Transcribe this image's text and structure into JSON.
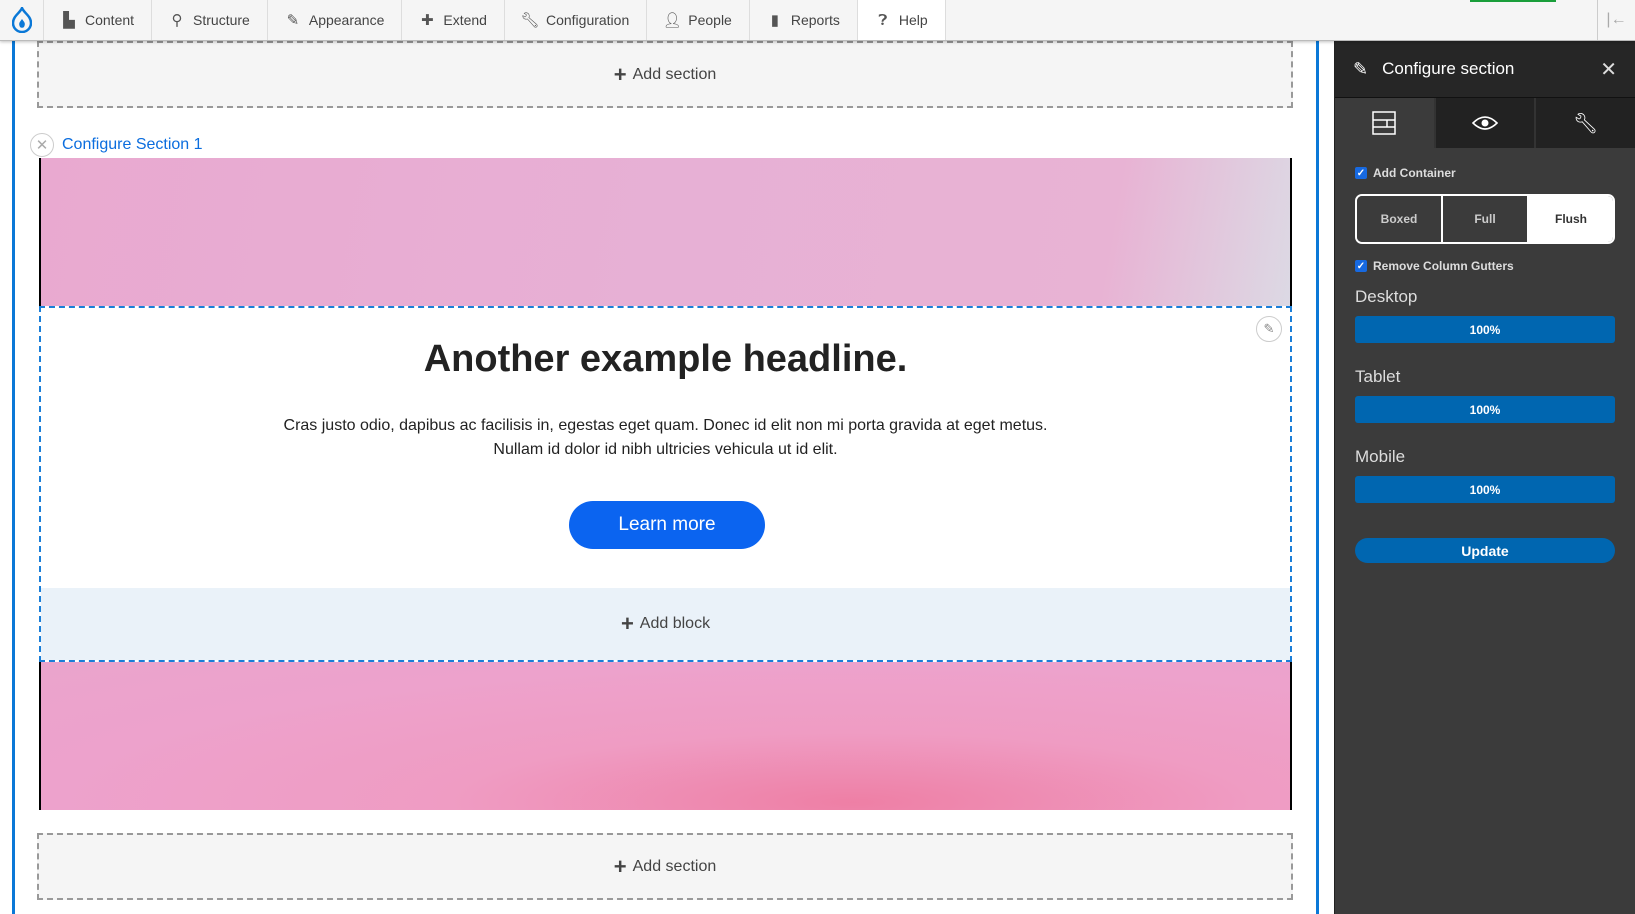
{
  "toolbar": {
    "items": [
      {
        "label": "Content",
        "icon": "file-icon"
      },
      {
        "label": "Structure",
        "icon": "sitemap-icon"
      },
      {
        "label": "Appearance",
        "icon": "brush-icon"
      },
      {
        "label": "Extend",
        "icon": "puzzle-icon"
      },
      {
        "label": "Configuration",
        "icon": "wrench-icon"
      },
      {
        "label": "People",
        "icon": "people-icon"
      },
      {
        "label": "Reports",
        "icon": "bar-chart-icon"
      },
      {
        "label": "Help",
        "icon": "help-icon"
      }
    ]
  },
  "canvas": {
    "add_section_label": "Add section",
    "configure_link": "Configure Section 1",
    "headline": "Another example headline.",
    "paragraph_line1": "Cras justo odio, dapibus ac facilisis in, egestas eget quam. Donec id elit non mi porta gravida at eget metus.",
    "paragraph_line2": "Nullam id dolor id nibh ultricies vehicula ut id elit.",
    "cta_label": "Learn more",
    "add_block_label": "Add block"
  },
  "panel": {
    "title": "Configure section",
    "add_container_label": "Add Container",
    "add_container_checked": true,
    "container_options": [
      "Boxed",
      "Full",
      "Flush"
    ],
    "container_selected": "Flush",
    "remove_gutters_label": "Remove Column Gutters",
    "remove_gutters_checked": true,
    "breakpoints": [
      {
        "label": "Desktop",
        "value": "100%"
      },
      {
        "label": "Tablet",
        "value": "100%"
      },
      {
        "label": "Mobile",
        "value": "100%"
      }
    ],
    "update_label": "Update"
  },
  "colors": {
    "accent": "#0066b0",
    "link": "#0b6dde",
    "cta": "#0b64f0",
    "panel_bg": "#3b3b3b"
  }
}
